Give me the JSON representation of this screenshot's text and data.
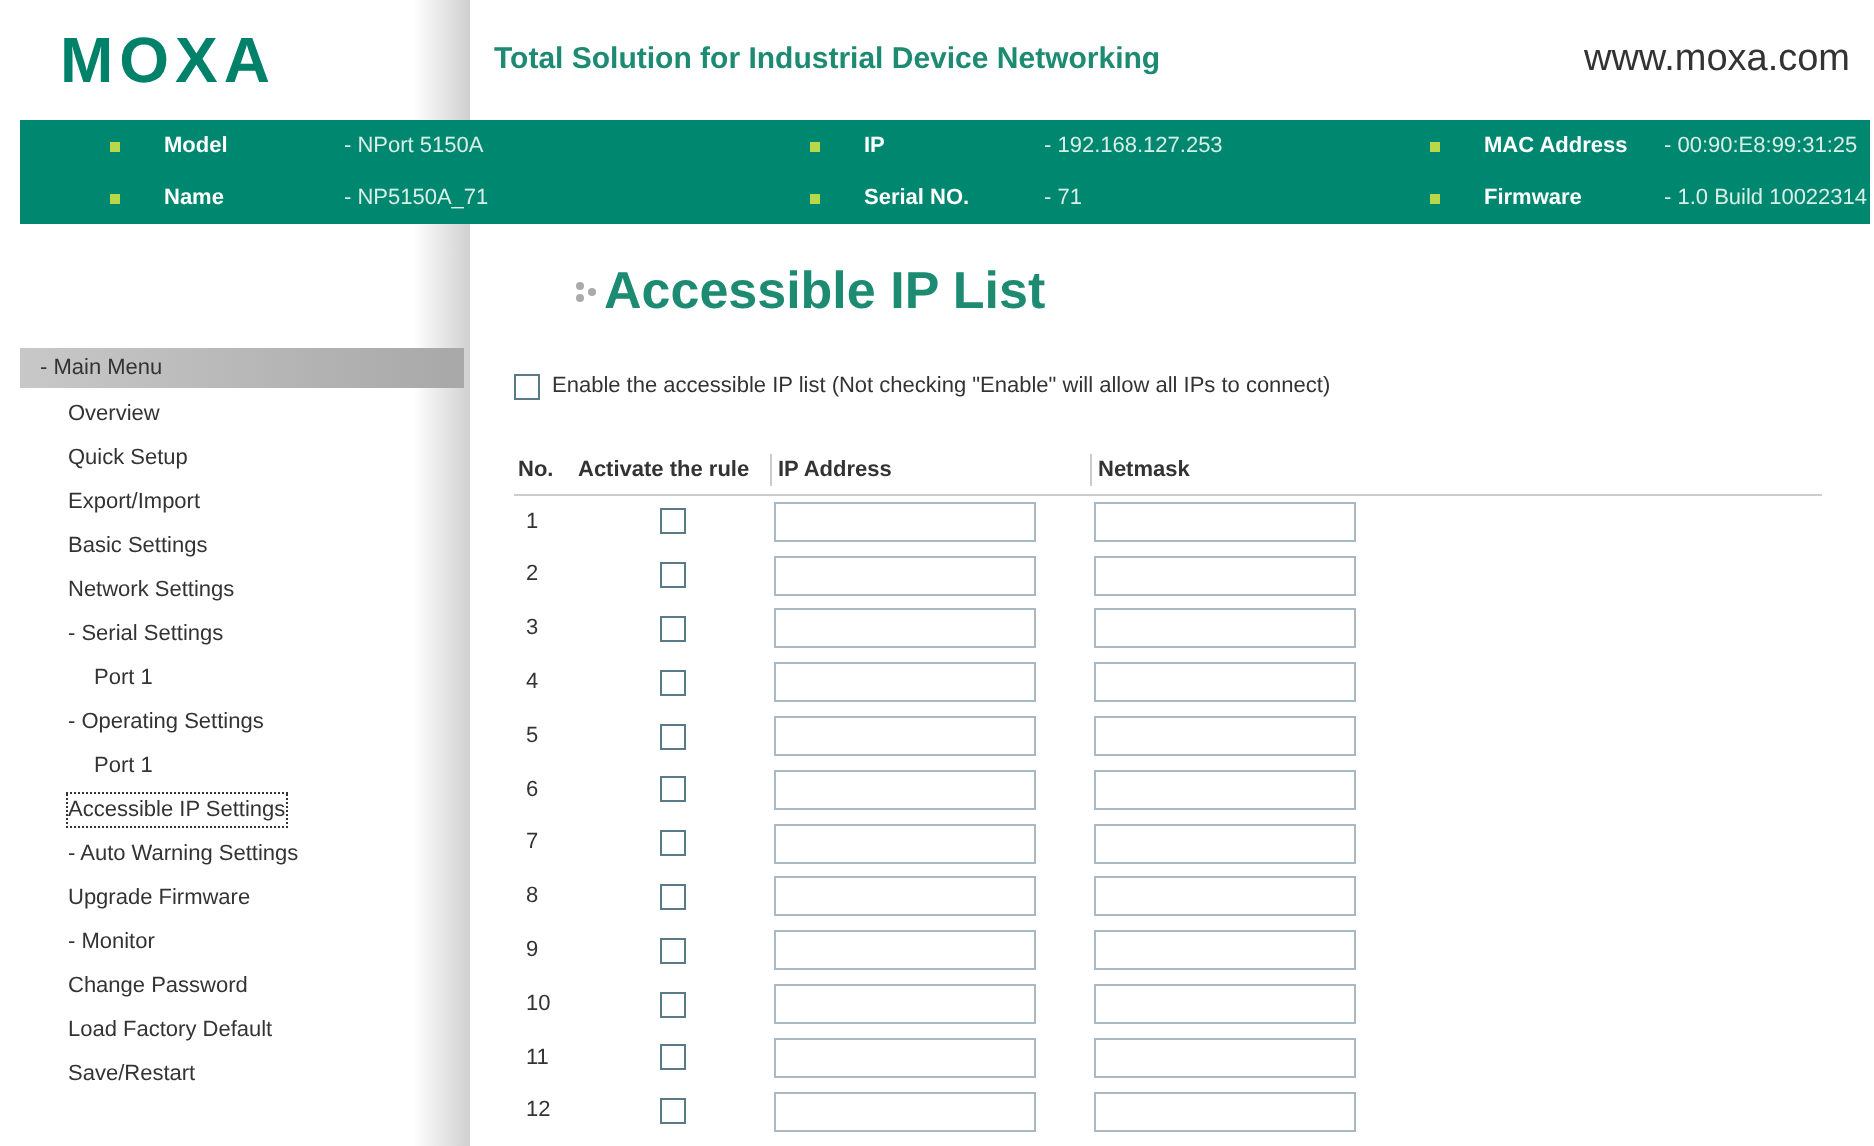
{
  "header": {
    "logo": "MOXA",
    "tagline": "Total Solution for Industrial Device Networking",
    "website": "www.moxa.com"
  },
  "info": [
    {
      "label": "Model",
      "value": "- NPort 5150A"
    },
    {
      "label": "IP",
      "value": "- 192.168.127.253"
    },
    {
      "label": "MAC Address",
      "value": "- 00:90:E8:99:31:25"
    },
    {
      "label": "Name",
      "value": "- NP5150A_71"
    },
    {
      "label": "Serial NO.",
      "value": "- 71"
    },
    {
      "label": "Firmware",
      "value": "- 1.0 Build 10022314"
    }
  ],
  "sidebar": {
    "title": "- Main Menu",
    "items": [
      {
        "label": "Overview",
        "selected": false
      },
      {
        "label": "Quick Setup",
        "selected": false
      },
      {
        "label": "Export/Import",
        "selected": false
      },
      {
        "label": "Basic Settings",
        "selected": false
      },
      {
        "label": "Network Settings",
        "selected": false
      },
      {
        "label": "- Serial Settings",
        "selected": false,
        "children": [
          {
            "label": "Port 1",
            "selected": false
          }
        ]
      },
      {
        "label": "- Operating Settings",
        "selected": false,
        "children": [
          {
            "label": "Port 1",
            "selected": false
          }
        ]
      },
      {
        "label": "Accessible IP Settings",
        "selected": true
      },
      {
        "label": "- Auto Warning Settings",
        "selected": false
      },
      {
        "label": "Upgrade Firmware",
        "selected": false
      },
      {
        "label": "- Monitor",
        "selected": false
      },
      {
        "label": "Change Password",
        "selected": false
      },
      {
        "label": "Load Factory Default",
        "selected": false
      },
      {
        "label": "Save/Restart",
        "selected": false
      }
    ]
  },
  "page": {
    "title": "Accessible IP List",
    "enable": {
      "label": "Enable the accessible IP list (Not checking \"Enable\" will allow all IPs to connect)",
      "checked": false
    }
  },
  "table": {
    "columns": [
      "No.",
      "Activate the rule",
      "IP Address",
      "Netmask"
    ],
    "rows": [
      {
        "no": "1",
        "checked": false
      },
      {
        "no": "2",
        "checked": false
      },
      {
        "no": "3",
        "checked": false
      },
      {
        "no": "4",
        "checked": false
      },
      {
        "no": "5",
        "checked": false
      },
      {
        "no": "6",
        "checked": false
      },
      {
        "no": "7",
        "checked": false
      },
      {
        "no": "8",
        "checked": false
      },
      {
        "no": "9",
        "checked": false
      },
      {
        "no": "10",
        "checked": false
      },
      {
        "no": "11",
        "checked": false
      },
      {
        "no": "12",
        "checked": false
      }
    ]
  }
}
